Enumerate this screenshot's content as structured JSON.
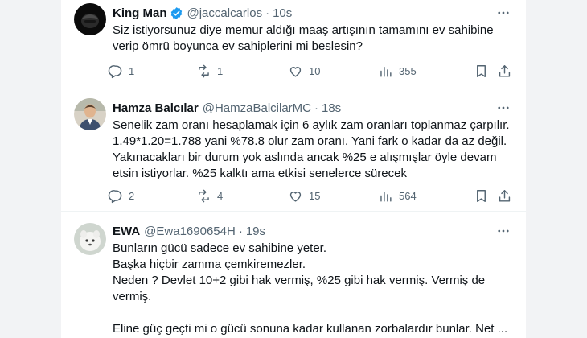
{
  "tweets": [
    {
      "name": "King Man",
      "handle": "@jaccalcarlos",
      "time": "10s",
      "verified": true,
      "lines": [
        "Siz istiyorsunuz diye memur aldığı maaş artışının tamamını ev sahibine",
        "verip ömrü boyunca ev sahiplerini mi beslesin?"
      ],
      "replies": "1",
      "retweets": "1",
      "likes": "10",
      "views": "355"
    },
    {
      "name": "Hamza Balcılar",
      "handle": "@HamzaBalcilarMC",
      "time": "18s",
      "verified": false,
      "lines": [
        "Senelik zam oranı hesaplamak için 6 aylık zam oranları toplanmaz çarpılır.",
        "1.49*1.20=1.788 yani %78.8 olur zam oranı. Yani fark o kadar da az değil.",
        "Yakınacakları bir durum yok aslında ancak %25 e alışmışlar öyle devam",
        "etsin istiyorlar. %25 kalktı ama etkisi senelerce sürecek"
      ],
      "replies": "2",
      "retweets": "4",
      "likes": "15",
      "views": "564"
    },
    {
      "name": "EWA",
      "handle": "@Ewa1690654H",
      "time": "19s",
      "verified": false,
      "lines": [
        "Bunların gücü sadece ev sahibine yeter.",
        "Başka hiçbir zamma çemkiremezler.",
        "Neden ? Devlet 10+2 gibi hak vermiş, %25 gibi hak vermiş. Vermiş de",
        "vermiş.",
        "",
        "Eline güç geçti mi o gücü sonuna kadar kullanan zorbalardır bunlar. Net ..."
      ]
    }
  ],
  "colors": {
    "secondary": "#536471",
    "verified": "#1d9bf0",
    "divider": "#eff3f4"
  }
}
